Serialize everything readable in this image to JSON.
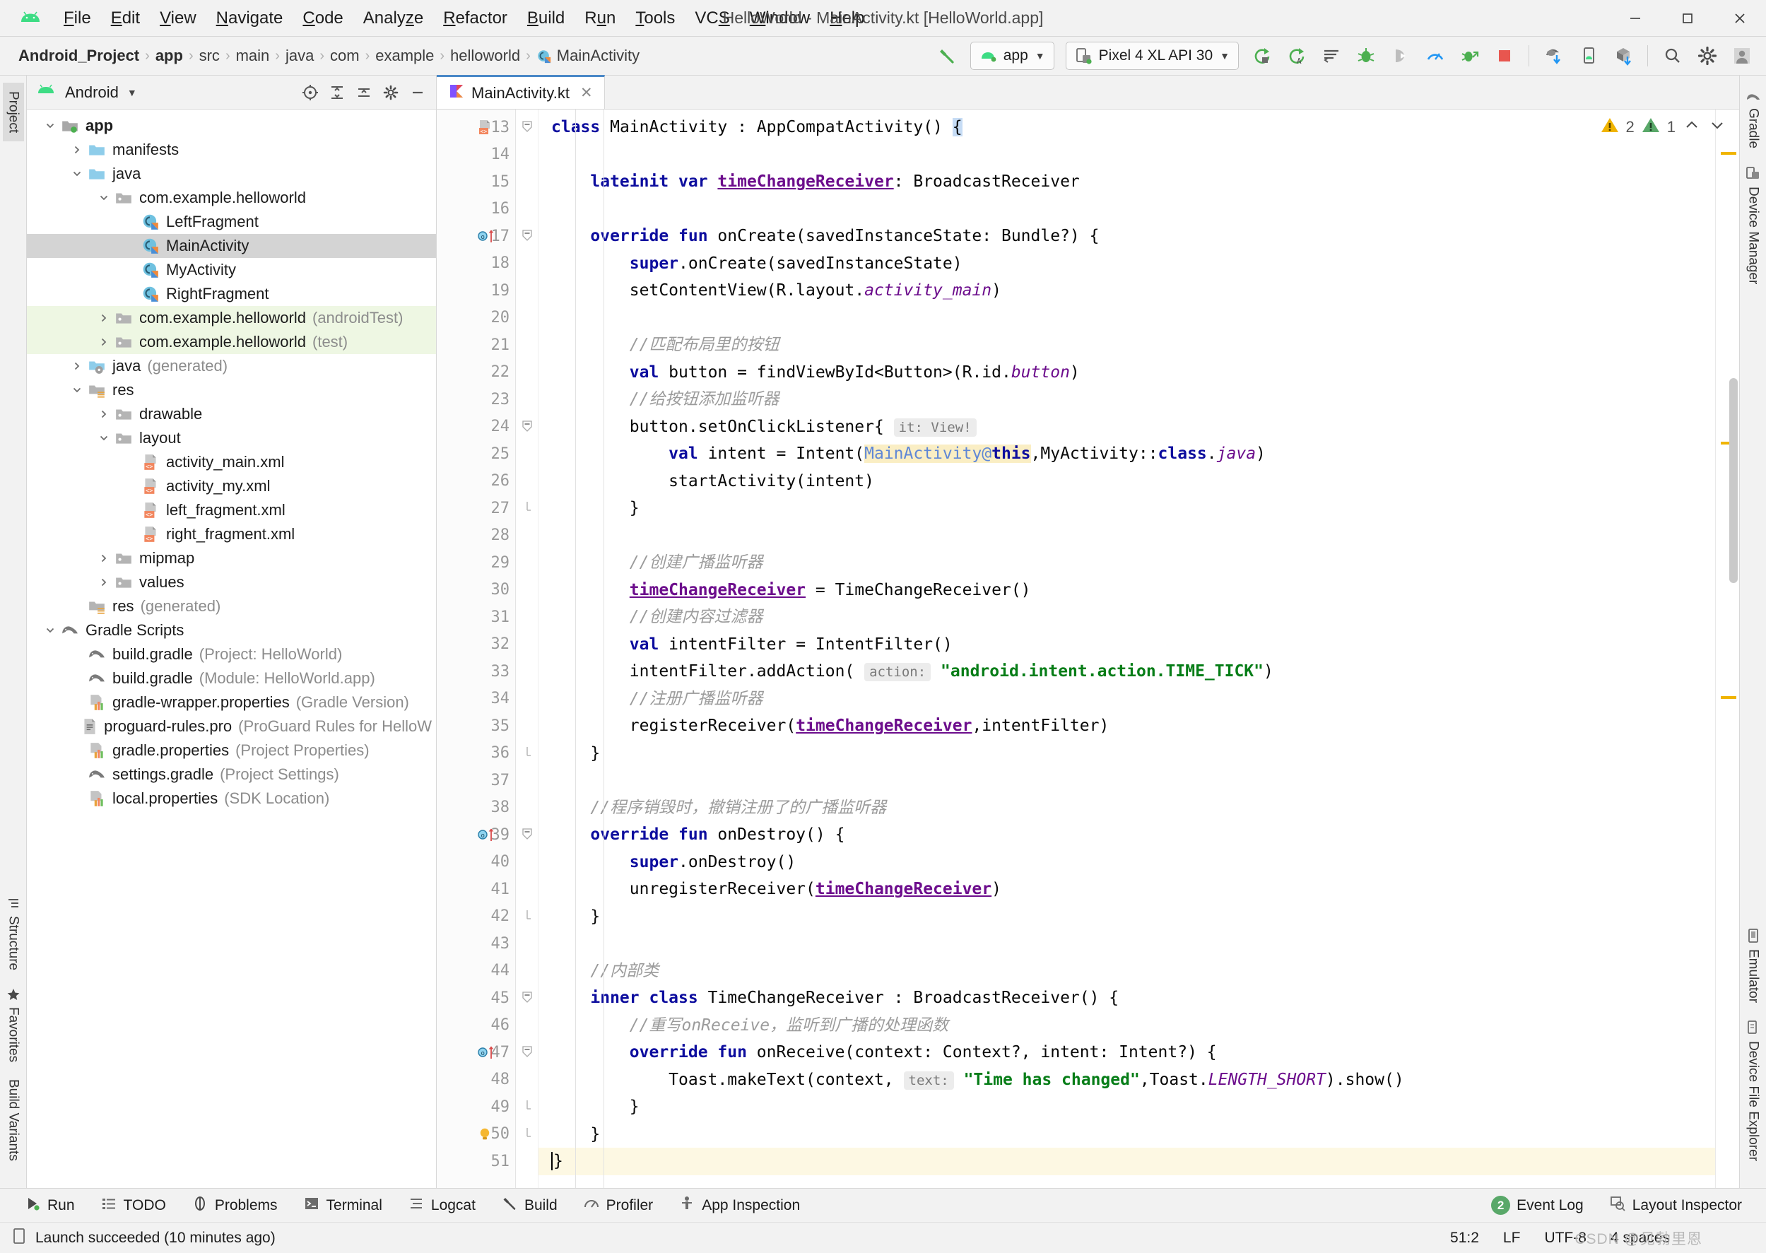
{
  "window": {
    "title": "HelloWorld - MainActivity.kt [HelloWorld.app]",
    "minimize": "–",
    "maximize": "☐",
    "close": "✕"
  },
  "menu": {
    "items": [
      {
        "label": "File",
        "mnemonic": "F"
      },
      {
        "label": "Edit",
        "mnemonic": "E"
      },
      {
        "label": "View",
        "mnemonic": "V"
      },
      {
        "label": "Navigate",
        "mnemonic": "N"
      },
      {
        "label": "Code",
        "mnemonic": "C"
      },
      {
        "label": "Analyze",
        "mnemonic": "z"
      },
      {
        "label": "Refactor",
        "mnemonic": "R"
      },
      {
        "label": "Build",
        "mnemonic": "B"
      },
      {
        "label": "Run",
        "mnemonic": "u"
      },
      {
        "label": "Tools",
        "mnemonic": "T"
      },
      {
        "label": "VCS",
        "mnemonic": "S"
      },
      {
        "label": "Window",
        "mnemonic": "W"
      },
      {
        "label": "Help",
        "mnemonic": "H"
      }
    ]
  },
  "breadcrumb": {
    "items": [
      {
        "label": "Android_Project",
        "bold": true,
        "icon": ""
      },
      {
        "label": "app",
        "bold": true,
        "icon": ""
      },
      {
        "label": "src",
        "bold": false,
        "icon": ""
      },
      {
        "label": "main",
        "bold": false,
        "icon": ""
      },
      {
        "label": "java",
        "bold": false,
        "icon": ""
      },
      {
        "label": "com",
        "bold": false,
        "icon": ""
      },
      {
        "label": "example",
        "bold": false,
        "icon": ""
      },
      {
        "label": "helloworld",
        "bold": false,
        "icon": ""
      },
      {
        "label": "MainActivity",
        "bold": false,
        "icon": "kotlin-class-icon"
      }
    ]
  },
  "toolbar": {
    "build_icon": "hammer-icon",
    "run_config": "app",
    "device": "Pixel 4 XL API 30",
    "caret": "▼",
    "icons": [
      "run-icon",
      "apply-changes-icon",
      "apply-code-changes-icon",
      "debug-icon",
      "attach-debugger-icon",
      "profiler-icon",
      "run-with-coverage-icon",
      "stop-icon",
      "sync-gradle-icon",
      "avd-manager-icon",
      "sdk-manager-icon",
      "search-icon",
      "settings-icon",
      "avatar-icon"
    ]
  },
  "left_strip": {
    "top": [
      "Project"
    ],
    "bottom": [
      "Structure",
      "Favorites",
      "Build Variants"
    ],
    "selected": "Project"
  },
  "right_strip": {
    "items": [
      "Gradle",
      "Device Manager",
      "Emulator",
      "Device File Explorer"
    ]
  },
  "project_panel": {
    "title": "Android",
    "caret": "▼",
    "actions": [
      "target-icon",
      "collapse-all-icon",
      "expand-icon",
      "settings-icon",
      "hide-icon"
    ],
    "tree": [
      {
        "depth": 0,
        "arrow": "down",
        "icon": "module-icon",
        "label": "app",
        "bold": true,
        "note": "",
        "state": "normal"
      },
      {
        "depth": 1,
        "arrow": "right",
        "icon": "folder-blue-icon",
        "label": "manifests",
        "bold": false,
        "note": "",
        "state": "normal"
      },
      {
        "depth": 1,
        "arrow": "down",
        "icon": "folder-blue-icon",
        "label": "java",
        "bold": false,
        "note": "",
        "state": "normal"
      },
      {
        "depth": 2,
        "arrow": "down",
        "icon": "package-icon",
        "label": "com.example.helloworld",
        "bold": false,
        "note": "",
        "state": "normal"
      },
      {
        "depth": 3,
        "arrow": "none",
        "icon": "kotlin-class-icon",
        "label": "LeftFragment",
        "bold": false,
        "note": "",
        "state": "normal"
      },
      {
        "depth": 3,
        "arrow": "none",
        "icon": "kotlin-class-icon",
        "label": "MainActivity",
        "bold": false,
        "note": "",
        "state": "selected"
      },
      {
        "depth": 3,
        "arrow": "none",
        "icon": "kotlin-class-icon",
        "label": "MyActivity",
        "bold": false,
        "note": "",
        "state": "normal"
      },
      {
        "depth": 3,
        "arrow": "none",
        "icon": "kotlin-class-icon",
        "label": "RightFragment",
        "bold": false,
        "note": "",
        "state": "normal"
      },
      {
        "depth": 2,
        "arrow": "right",
        "icon": "package-icon",
        "label": "com.example.helloworld",
        "bold": false,
        "note": "(androidTest)",
        "state": "testsrc"
      },
      {
        "depth": 2,
        "arrow": "right",
        "icon": "package-icon",
        "label": "com.example.helloworld",
        "bold": false,
        "note": "(test)",
        "state": "testsrc"
      },
      {
        "depth": 1,
        "arrow": "right",
        "icon": "folder-generated-icon",
        "label": "java",
        "bold": false,
        "note": "(generated)",
        "state": "normal"
      },
      {
        "depth": 1,
        "arrow": "down",
        "icon": "folder-res-icon",
        "label": "res",
        "bold": false,
        "note": "",
        "state": "normal"
      },
      {
        "depth": 2,
        "arrow": "right",
        "icon": "package-icon",
        "label": "drawable",
        "bold": false,
        "note": "",
        "state": "normal"
      },
      {
        "depth": 2,
        "arrow": "down",
        "icon": "package-icon",
        "label": "layout",
        "bold": false,
        "note": "",
        "state": "normal"
      },
      {
        "depth": 3,
        "arrow": "none",
        "icon": "xml-layout-icon",
        "label": "activity_main.xml",
        "bold": false,
        "note": "",
        "state": "normal"
      },
      {
        "depth": 3,
        "arrow": "none",
        "icon": "xml-layout-icon",
        "label": "activity_my.xml",
        "bold": false,
        "note": "",
        "state": "normal"
      },
      {
        "depth": 3,
        "arrow": "none",
        "icon": "xml-layout-icon",
        "label": "left_fragment.xml",
        "bold": false,
        "note": "",
        "state": "normal"
      },
      {
        "depth": 3,
        "arrow": "none",
        "icon": "xml-layout-icon",
        "label": "right_fragment.xml",
        "bold": false,
        "note": "",
        "state": "normal"
      },
      {
        "depth": 2,
        "arrow": "right",
        "icon": "package-icon",
        "label": "mipmap",
        "bold": false,
        "note": "",
        "state": "normal"
      },
      {
        "depth": 2,
        "arrow": "right",
        "icon": "package-icon",
        "label": "values",
        "bold": false,
        "note": "",
        "state": "normal"
      },
      {
        "depth": 1,
        "arrow": "none",
        "icon": "folder-res-icon",
        "label": "res",
        "bold": false,
        "note": "(generated)",
        "state": "normal"
      },
      {
        "depth": 0,
        "arrow": "down",
        "icon": "gradle-icon",
        "label": "Gradle Scripts",
        "bold": false,
        "note": "",
        "state": "normal"
      },
      {
        "depth": 1,
        "arrow": "none",
        "icon": "gradle-icon",
        "label": "build.gradle",
        "bold": false,
        "note": "(Project: HelloWorld)",
        "state": "normal"
      },
      {
        "depth": 1,
        "arrow": "none",
        "icon": "gradle-icon",
        "label": "build.gradle",
        "bold": false,
        "note": "(Module: HelloWorld.app)",
        "state": "normal"
      },
      {
        "depth": 1,
        "arrow": "none",
        "icon": "properties-icon",
        "label": "gradle-wrapper.properties",
        "bold": false,
        "note": "(Gradle Version)",
        "state": "normal"
      },
      {
        "depth": 1,
        "arrow": "none",
        "icon": "text-file-icon",
        "label": "proguard-rules.pro",
        "bold": false,
        "note": "(ProGuard Rules for HelloW",
        "state": "normal"
      },
      {
        "depth": 1,
        "arrow": "none",
        "icon": "properties-icon",
        "label": "gradle.properties",
        "bold": false,
        "note": "(Project Properties)",
        "state": "normal"
      },
      {
        "depth": 1,
        "arrow": "none",
        "icon": "gradle-icon",
        "label": "settings.gradle",
        "bold": false,
        "note": "(Project Settings)",
        "state": "normal"
      },
      {
        "depth": 1,
        "arrow": "none",
        "icon": "properties-icon",
        "label": "local.properties",
        "bold": false,
        "note": "(SDK Location)",
        "state": "normal"
      }
    ]
  },
  "editor": {
    "tab": {
      "label": "MainActivity.kt",
      "icon": "kotlin-file-icon",
      "close": "✕"
    },
    "warnings": {
      "warning_count": "2",
      "weak_count": "1",
      "up": "⌃",
      "down": "⌄"
    },
    "first_line_number": 13,
    "cursor_line": 51,
    "lines": [
      {
        "n": 13,
        "gmark": "xml-layout-icon",
        "fold": "collapse",
        "html": "<span class=\"kw\">class</span> MainActivity : AppCompatActivity() <span class=\"hl-brace\">{</span>"
      },
      {
        "n": 14,
        "gmark": "",
        "fold": "",
        "html": ""
      },
      {
        "n": 15,
        "gmark": "",
        "fold": "",
        "html": "    <span class=\"kw\">lateinit var</span> <span class=\"fld\">timeChangeReceiver</span>: BroadcastReceiver"
      },
      {
        "n": 16,
        "gmark": "",
        "fold": "",
        "html": ""
      },
      {
        "n": 17,
        "gmark": "override-method-icon",
        "fold": "collapse",
        "html": "    <span class=\"kw\">override fun</span> onCreate(savedInstanceState: Bundle?) {"
      },
      {
        "n": 18,
        "gmark": "",
        "fold": "",
        "html": "        <span class=\"kw\">super</span>.onCreate(savedInstanceState)"
      },
      {
        "n": 19,
        "gmark": "",
        "fold": "",
        "html": "        setContentView(R.layout.<span class=\"stat\">activity_main</span>)"
      },
      {
        "n": 20,
        "gmark": "",
        "fold": "",
        "html": ""
      },
      {
        "n": 21,
        "gmark": "",
        "fold": "",
        "html": "        <span class=\"cmt\">//匹配布局里的按钮</span>"
      },
      {
        "n": 22,
        "gmark": "",
        "fold": "",
        "html": "        <span class=\"kw\">val</span> button = findViewById&lt;Button&gt;(R.id.<span class=\"stat\">button</span>)"
      },
      {
        "n": 23,
        "gmark": "",
        "fold": "",
        "html": "        <span class=\"cmt\">//给按钮添加监听器</span>"
      },
      {
        "n": 24,
        "gmark": "",
        "fold": "collapse",
        "html": "        button.setOnClickListener{ <span class=\"hint\">it: View!</span>"
      },
      {
        "n": 25,
        "gmark": "",
        "fold": "",
        "html": "            <span class=\"kw\">val</span> intent = Intent(<span class=\"hl-yellow\"><span class=\"blue\">MainActivity@</span><span class=\"kw\">this</span></span>,MyActivity::<span class=\"kw\">class</span>.<span class=\"stat\">java</span>)"
      },
      {
        "n": 26,
        "gmark": "",
        "fold": "",
        "html": "            startActivity(intent)"
      },
      {
        "n": 27,
        "gmark": "",
        "fold": "collapse-end",
        "html": "        }"
      },
      {
        "n": 28,
        "gmark": "",
        "fold": "",
        "html": ""
      },
      {
        "n": 29,
        "gmark": "",
        "fold": "",
        "html": "        <span class=\"cmt\">//创建广播监听器</span>"
      },
      {
        "n": 30,
        "gmark": "",
        "fold": "",
        "html": "        <span class=\"fld\">timeChangeReceiver</span> = TimeChangeReceiver()"
      },
      {
        "n": 31,
        "gmark": "",
        "fold": "",
        "html": "        <span class=\"cmt\">//创建内容过滤器</span>"
      },
      {
        "n": 32,
        "gmark": "",
        "fold": "",
        "html": "        <span class=\"kw\">val</span> intentFilter = IntentFilter()"
      },
      {
        "n": 33,
        "gmark": "",
        "fold": "",
        "html": "        intentFilter.addAction( <span class=\"hint\">action:</span> <span class=\"str\">\"android.intent.action.TIME_TICK\"</span>)"
      },
      {
        "n": 34,
        "gmark": "",
        "fold": "",
        "html": "        <span class=\"cmt\">//注册广播监听器</span>"
      },
      {
        "n": 35,
        "gmark": "",
        "fold": "",
        "html": "        registerReceiver(<span class=\"fld\">timeChangeReceiver</span>,intentFilter)"
      },
      {
        "n": 36,
        "gmark": "",
        "fold": "collapse-end",
        "html": "    }"
      },
      {
        "n": 37,
        "gmark": "",
        "fold": "",
        "html": ""
      },
      {
        "n": 38,
        "gmark": "",
        "fold": "",
        "html": "    <span class=\"cmt\">//程序销毁时，撤销注册了的广播监听器</span>"
      },
      {
        "n": 39,
        "gmark": "override-method-icon",
        "fold": "collapse",
        "html": "    <span class=\"kw\">override fun</span> onDestroy() {"
      },
      {
        "n": 40,
        "gmark": "",
        "fold": "",
        "html": "        <span class=\"kw\">super</span>.onDestroy()"
      },
      {
        "n": 41,
        "gmark": "",
        "fold": "",
        "html": "        unregisterReceiver(<span class=\"fld\">timeChangeReceiver</span>)"
      },
      {
        "n": 42,
        "gmark": "",
        "fold": "collapse-end",
        "html": "    }"
      },
      {
        "n": 43,
        "gmark": "",
        "fold": "",
        "html": ""
      },
      {
        "n": 44,
        "gmark": "",
        "fold": "",
        "html": "    <span class=\"cmt\">//内部类</span>"
      },
      {
        "n": 45,
        "gmark": "",
        "fold": "collapse",
        "html": "    <span class=\"kw\">inner class</span> TimeChangeReceiver : BroadcastReceiver() {"
      },
      {
        "n": 46,
        "gmark": "",
        "fold": "",
        "html": "        <span class=\"cmt\">//重写onReceive，监听到广播的处理函数</span>"
      },
      {
        "n": 47,
        "gmark": "override-method-icon",
        "fold": "collapse",
        "html": "        <span class=\"kw\">override fun</span> onReceive(context: Context?, intent: Intent?) {"
      },
      {
        "n": 48,
        "gmark": "",
        "fold": "",
        "html": "            Toast.makeText(context, <span class=\"hint\">text:</span> <span class=\"str\">\"Time has changed\"</span>,Toast.<span class=\"stat\">LENGTH_SHORT</span>).show()"
      },
      {
        "n": 49,
        "gmark": "",
        "fold": "collapse-end",
        "html": "        }"
      },
      {
        "n": 50,
        "gmark": "bulb-icon",
        "fold": "collapse-end",
        "html": "    }"
      },
      {
        "n": 51,
        "gmark": "",
        "fold": "",
        "html": "<span class=\"caret-brace\">}</span>"
      }
    ]
  },
  "bottom_bar": {
    "items": [
      {
        "label": "Run",
        "icon": "run-icon"
      },
      {
        "label": "TODO",
        "icon": "todo-icon"
      },
      {
        "label": "Problems",
        "icon": "problems-icon"
      },
      {
        "label": "Terminal",
        "icon": "terminal-icon"
      },
      {
        "label": "Logcat",
        "icon": "logcat-icon"
      },
      {
        "label": "Build",
        "icon": "build-icon"
      },
      {
        "label": "Profiler",
        "icon": "profiler-icon"
      },
      {
        "label": "App Inspection",
        "icon": "app-inspection-icon"
      }
    ],
    "right": [
      {
        "label": "Event Log",
        "icon": "event-log-badge",
        "badge": "2"
      },
      {
        "label": "Layout Inspector",
        "icon": "layout-inspector-icon",
        "badge": ""
      }
    ]
  },
  "status_bar": {
    "message": "Launch succeeded (10 minutes ago)",
    "icon": "device-icon",
    "caret_position": "51:2",
    "line_separator": "LF",
    "encoding": "UTF-8",
    "indent": "4 spaces",
    "watermark": "CSDN @见勃里恩"
  },
  "colors": {
    "accent": "#4a88c7",
    "android_green": "#3ddc84",
    "warning_yellow": "#f0b400",
    "weak_green": "#59a869",
    "selection_gray": "#d4d4d4",
    "test_src_green": "#eef7e3",
    "string_green": "#067d17",
    "keyword_blue": "#0d0d9e",
    "field_purple": "#6c0d8c",
    "comment_gray": "#9b9b9b",
    "cursor_line": "#fdf8e3"
  }
}
